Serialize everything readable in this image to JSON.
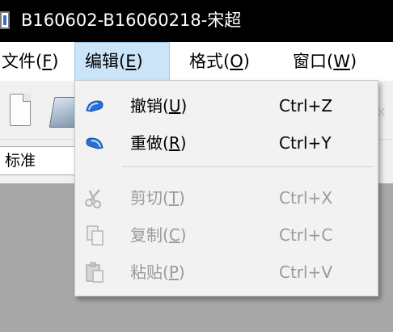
{
  "window": {
    "title": "B160602-B16060218-宋超"
  },
  "menubar": {
    "items": [
      {
        "label": "文件(",
        "mn": "F",
        "end": ")"
      },
      {
        "label": "编辑(",
        "mn": "E",
        "end": ")"
      },
      {
        "label": "格式(",
        "mn": "O",
        "end": ")"
      },
      {
        "label": "窗口(",
        "mn": "W",
        "end": ")"
      }
    ]
  },
  "format_bar": {
    "style_value": "标准"
  },
  "edit_menu": {
    "items": [
      {
        "label": "撤销(",
        "mn": "U",
        "end": ")",
        "shortcut": "Ctrl+Z",
        "icon": "undo-icon",
        "enabled": true
      },
      {
        "label": "重做(",
        "mn": "R",
        "end": ")",
        "shortcut": "Ctrl+Y",
        "icon": "redo-icon",
        "enabled": true
      },
      {
        "label": "剪切(",
        "mn": "T",
        "end": ")",
        "shortcut": "Ctrl+X",
        "icon": "scissors-icon",
        "enabled": false
      },
      {
        "label": "复制(",
        "mn": "C",
        "end": ")",
        "shortcut": "Ctrl+C",
        "icon": "copy-icon",
        "enabled": false
      },
      {
        "label": "粘贴(",
        "mn": "P",
        "end": ")",
        "shortcut": "Ctrl+V",
        "icon": "paste-icon",
        "enabled": false
      }
    ]
  },
  "colors": {
    "menu_highlight": "#cce4f7",
    "disabled_text": "#9a9a9a",
    "workspace": "#a8a8a8"
  }
}
